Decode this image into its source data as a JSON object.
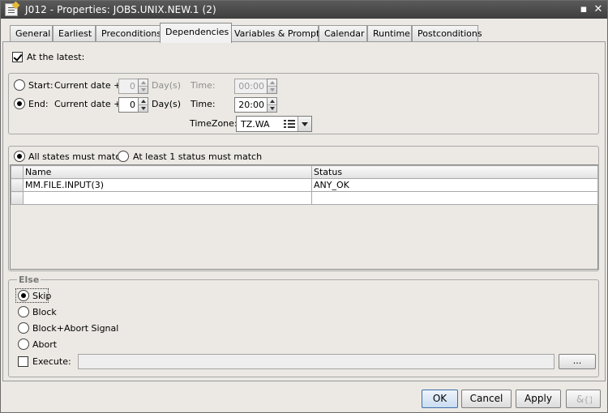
{
  "window": {
    "title": "J012 - Properties: JOBS.UNIX.NEW.1 (2)",
    "icon": "properties-icon",
    "minimize_glyph": "▪",
    "close_glyph": "✕"
  },
  "tabs": [
    {
      "label": "General"
    },
    {
      "label": "Earliest"
    },
    {
      "label": "Preconditions"
    },
    {
      "label": "Dependencies",
      "active": true
    },
    {
      "label": "Variables & Prompts"
    },
    {
      "label": "Calendar"
    },
    {
      "label": "Runtime"
    },
    {
      "label": "Postconditions"
    }
  ],
  "at_latest": {
    "label": "At the latest:",
    "checked": true,
    "start": {
      "label": "Start:",
      "current_date_label": "Current date +",
      "days_value": "0",
      "days_unit": "Day(s)",
      "time_label": "Time:",
      "time_value": "00:00",
      "selected": false
    },
    "end": {
      "label": "End:",
      "current_date_label": "Current date +",
      "days_value": "0",
      "days_unit": "Day(s)",
      "time_label": "Time:",
      "time_value": "20:00",
      "selected": true
    },
    "timezone": {
      "label": "TimeZone:",
      "value": "TZ.WA"
    }
  },
  "states": {
    "option_all": "All states must match",
    "option_one": "At least 1 status must match",
    "selected": "all",
    "table": {
      "columns": [
        "Name",
        "Status"
      ],
      "rows": [
        {
          "name": "MM.FILE.INPUT(3)",
          "status": "ANY_OK"
        },
        {
          "name": "",
          "status": ""
        }
      ]
    }
  },
  "else": {
    "legend": "Else",
    "options": [
      "Skip",
      "Block",
      "Block+Abort Signal",
      "Abort"
    ],
    "selected": "Skip",
    "execute_label": "Execute:",
    "execute_value": "",
    "browse_label": "..."
  },
  "footer": {
    "ok": "OK",
    "cancel": "Cancel",
    "apply": "Apply",
    "extra_icon": "variables-icon"
  }
}
